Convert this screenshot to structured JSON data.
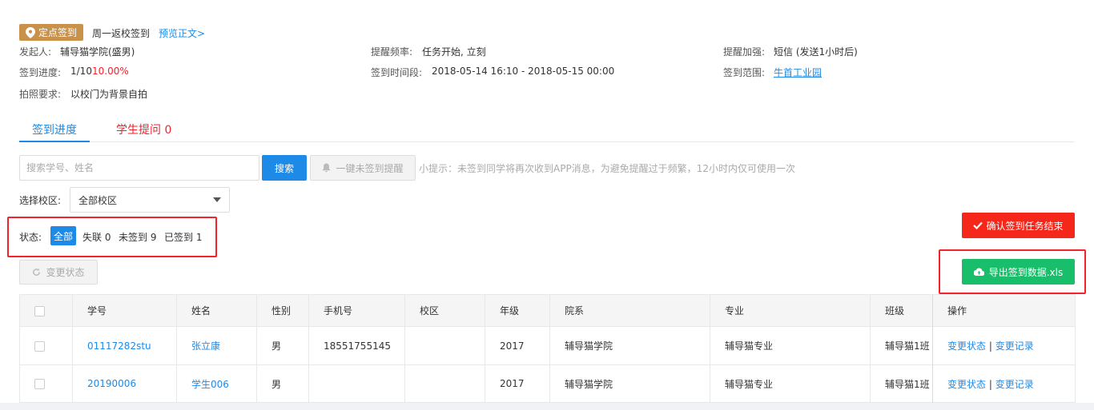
{
  "task": {
    "badge_label": "定点签到",
    "title": "周一返校签到",
    "preview_link": "预览正文>"
  },
  "info": {
    "initiator_label": "发起人:",
    "initiator_value": "辅导猫学院(盛男)",
    "reminder_freq_label": "提醒频率:",
    "reminder_freq_value": "任务开始, 立刻",
    "reminder_boost_label": "提醒加强:",
    "reminder_boost_value": "短信 (发送1小时后)",
    "progress_label": "签到进度:",
    "progress_count": "1/10",
    "progress_percent": "10.00%",
    "period_label": "签到时间段:",
    "period_value": "2018-05-14 16:10 - 2018-05-15 00:00",
    "range_label": "签到范围:",
    "range_value": "牛首工业园",
    "photo_label": "拍照要求:",
    "photo_value": "以校门为背景自拍"
  },
  "tabs": [
    {
      "label": "签到进度",
      "active": true
    },
    {
      "label": "学生提问 0",
      "active": false
    }
  ],
  "toolbar": {
    "search_placeholder": "搜索学号、姓名",
    "search_button": "搜索",
    "remind_button": "一键未签到提醒",
    "hint": "小提示：未签到同学将再次收到APP消息，为避免提醒过于频繁，12小时内仅可使用一次",
    "campus_label": "选择校区:",
    "campus_value": "全部校区",
    "status_label": "状态:",
    "status_all": "全部",
    "status_lost": "失联 0",
    "status_unsigned": "未签到 9",
    "status_signed": "已签到 1",
    "change_status_button": "变更状态",
    "confirm_button": "确认签到任务结束",
    "export_button": "导出签到数据.xls"
  },
  "table": {
    "headers": [
      "学号",
      "姓名",
      "性别",
      "手机号",
      "校区",
      "年级",
      "院系",
      "专业",
      "班级",
      "操作"
    ],
    "rows": [
      {
        "id": "01117282stu",
        "name": "张立康",
        "gender": "男",
        "phone": "18551755145",
        "campus": "",
        "grade": "2017",
        "dept": "辅导猫学院",
        "major": "辅导猫专业",
        "class": "辅导猫1班",
        "op1": "变更状态",
        "op2": "变更记录"
      },
      {
        "id": "20190006",
        "name": "学生006",
        "gender": "男",
        "phone": "",
        "campus": "",
        "grade": "2017",
        "dept": "辅导猫学院",
        "major": "辅导猫专业",
        "class": "辅导猫1班",
        "op1": "变更状态",
        "op2": "变更记录"
      }
    ],
    "op_separator": "|"
  },
  "colors": {
    "primary": "#1e8ae8",
    "danger": "#f5271b",
    "success": "#19be6b",
    "badge": "#c8924a"
  }
}
